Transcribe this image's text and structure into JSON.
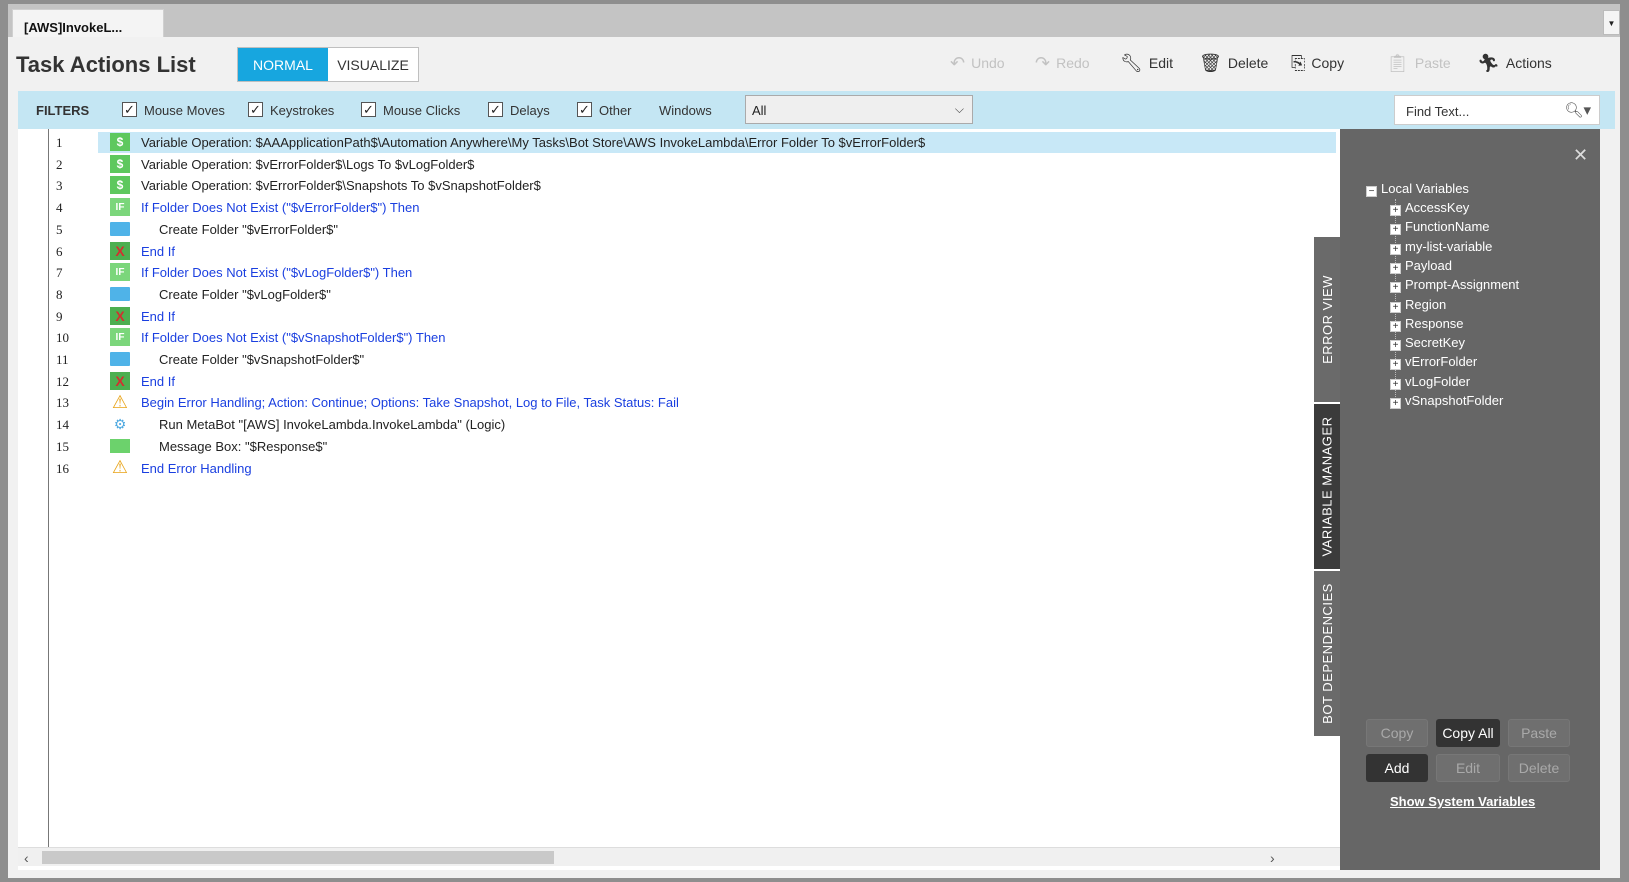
{
  "document_tab": {
    "label": "[AWS]InvokeL..."
  },
  "header": {
    "title": "Task Actions List",
    "mode_normal": "NORMAL",
    "mode_visualize": "VISUALIZE"
  },
  "toolbar": {
    "undo": "Undo",
    "redo": "Redo",
    "edit": "Edit",
    "delete": "Delete",
    "copy": "Copy",
    "paste": "Paste",
    "actions": "Actions"
  },
  "filters": {
    "title": "FILTERS",
    "mouse_moves": "Mouse Moves",
    "keystrokes": "Keystrokes",
    "mouse_clicks": "Mouse Clicks",
    "delays": "Delays",
    "other": "Other",
    "windows_label": "Windows",
    "windows_value": "All",
    "find_placeholder": "Find Text..."
  },
  "actions": [
    {
      "num": "1",
      "icon": "dollar",
      "text": "Variable Operation: $AAApplicationPath$\\Automation Anywhere\\My Tasks\\Bot Store\\AWS InvokeLambda\\Error Folder To $vErrorFolder$",
      "blue": false,
      "indent": 0
    },
    {
      "num": "2",
      "icon": "dollar",
      "text": "Variable Operation: $vErrorFolder$\\Logs To $vLogFolder$",
      "blue": false,
      "indent": 0
    },
    {
      "num": "3",
      "icon": "dollar",
      "text": "Variable Operation: $vErrorFolder$\\Snapshots To $vSnapshotFolder$",
      "blue": false,
      "indent": 0
    },
    {
      "num": "4",
      "icon": "if",
      "text": "If Folder Does Not Exist (\"$vErrorFolder$\")  Then",
      "blue": true,
      "indent": 0
    },
    {
      "num": "5",
      "icon": "folder",
      "text": "Create Folder \"$vErrorFolder$\"",
      "blue": false,
      "indent": 1
    },
    {
      "num": "6",
      "icon": "endif",
      "text": "End If",
      "blue": true,
      "indent": 0
    },
    {
      "num": "7",
      "icon": "if",
      "text": "If Folder Does Not Exist (\"$vLogFolder$\")  Then",
      "blue": true,
      "indent": 0
    },
    {
      "num": "8",
      "icon": "folder",
      "text": "Create Folder \"$vLogFolder$\"",
      "blue": false,
      "indent": 1
    },
    {
      "num": "9",
      "icon": "endif",
      "text": "End If",
      "blue": true,
      "indent": 0
    },
    {
      "num": "10",
      "icon": "if",
      "text": "If Folder Does Not Exist (\"$vSnapshotFolder$\")  Then",
      "blue": true,
      "indent": 0
    },
    {
      "num": "11",
      "icon": "folder",
      "text": "Create Folder \"$vSnapshotFolder$\"",
      "blue": false,
      "indent": 1
    },
    {
      "num": "12",
      "icon": "endif",
      "text": "End If",
      "blue": true,
      "indent": 0
    },
    {
      "num": "13",
      "icon": "warn",
      "text": "Begin Error Handling; Action: Continue; Options: Take Snapshot, Log to File,  Task Status: Fail",
      "blue": true,
      "indent": 0
    },
    {
      "num": "14",
      "icon": "metabot",
      "text": "Run MetaBot \"[AWS] InvokeLambda.InvokeLambda\" (Logic)",
      "blue": false,
      "indent": 1
    },
    {
      "num": "15",
      "icon": "msg",
      "text": "Message Box: \"$Response$\"",
      "blue": false,
      "indent": 1
    },
    {
      "num": "16",
      "icon": "warn",
      "text": "End Error Handling",
      "blue": true,
      "indent": 0
    }
  ],
  "side_tabs": {
    "error_view": "ERROR VIEW",
    "variable_manager": "VARIABLE MANAGER",
    "bot_dependencies": "BOT DEPENDENCIES"
  },
  "variable_manager": {
    "root": "Local Variables",
    "variables": [
      "AccessKey",
      "FunctionName",
      "my-list-variable",
      "Payload",
      "Prompt-Assignment",
      "Region",
      "Response",
      "SecretKey",
      "vErrorFolder",
      "vLogFolder",
      "vSnapshotFolder"
    ],
    "copy": "Copy",
    "copy_all": "Copy All",
    "paste": "Paste",
    "add": "Add",
    "edit": "Edit",
    "delete": "Delete",
    "show_system": "Show System Variables"
  },
  "colors": {
    "accent": "#17a6df",
    "filter_bar": "#c4e6f3",
    "selected_row": "#c8e8f7",
    "link_blue": "#1a3fe0",
    "panel_bg": "#666666"
  }
}
